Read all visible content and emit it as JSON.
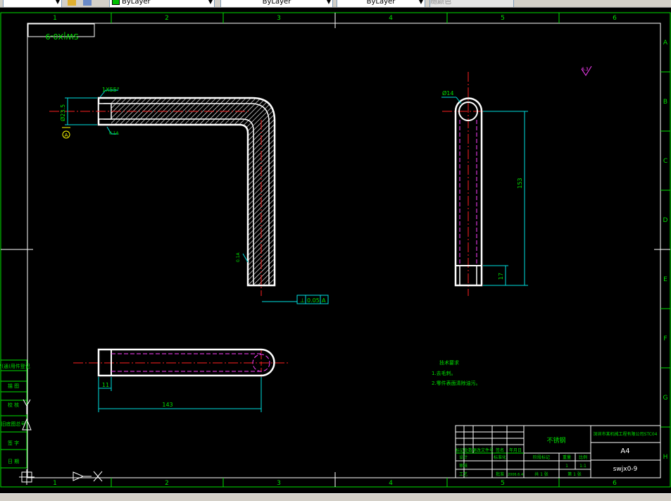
{
  "toolbar": {
    "layer_color_label": "ByLayer",
    "linetype_label": "ByLayer",
    "lineweight_label": "ByLayer",
    "plotstyle_label": "随颜色"
  },
  "frame": {
    "columns": [
      "1",
      "2",
      "3",
      "4",
      "5",
      "6"
    ],
    "rows": [
      "A",
      "B",
      "C",
      "D",
      "E",
      "F",
      "G",
      "H"
    ],
    "corner_tag": "SW|X0-9"
  },
  "left_strip": [
    "借(通)用件登记",
    "描 图",
    "校 核",
    "旧底图总号",
    "签 字",
    "日 期"
  ],
  "dims": {
    "chamfer": "1X55°",
    "dia_23": "Ø23.5",
    "datum_a": "A",
    "roughness_1": "0.1A",
    "roughness_2": "0.1A",
    "tolerance": "0.05",
    "tol_datum": "A",
    "dia_14": "Ø14",
    "len_153": "153",
    "len_17": "17",
    "len_11": "11",
    "len_143": "143",
    "surface": "6.3"
  },
  "notes": {
    "title": "技术要求",
    "line1": "1.去毛刺。",
    "line2": "2.零件表面清除油污。"
  },
  "title_block": {
    "material": "不锈钢",
    "company": "深圳市某机械工程有限公司STC04",
    "size": "A4",
    "drawing_no": "swjx0-9",
    "scale": "1:1",
    "quantity": "1",
    "stage": "阶段标记",
    "weight": "重量",
    "ratio": "比例",
    "sheet": "共 1 张",
    "sheet2": "第 1 张",
    "rev_mark": "标记",
    "rev_count": "处数",
    "rev_zone": "分区",
    "rev_doc": "更改文件号",
    "rev_sign": "签名",
    "rev_date": "年月日",
    "designer": "设计",
    "std": "标准化",
    "checker": "审核",
    "process": "工艺",
    "approve": "批准",
    "date_val": "2006.6.4"
  }
}
